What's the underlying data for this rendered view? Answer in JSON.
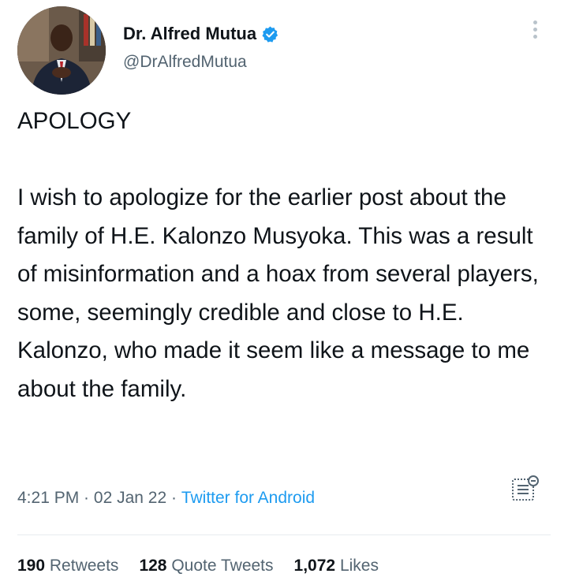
{
  "author": {
    "display_name": "Dr. Alfred Mutua",
    "handle": "@DrAlfredMutua",
    "verified": true,
    "avatar_icon": "profile-photo"
  },
  "tweet": {
    "paragraphs": [
      "APOLOGY",
      "I wish to apologize for the earlier post about the family of H.E. Kalonzo Musyoka. This was a result of misinformation and a hoax from several players, some, seemingly credible and close to H.E. Kalonzo, who made it seem like a message to me about the family."
    ],
    "time": "4:21 PM",
    "date": "02 Jan 22",
    "separator": " · ",
    "source": "Twitter for Android"
  },
  "stats": {
    "retweets_count": "190",
    "retweets_label": "Retweets",
    "quotes_count": "128",
    "quotes_label": "Quote Tweets",
    "likes_count": "1,072",
    "likes_label": "Likes"
  },
  "icons": {
    "verified": "verified-badge-icon",
    "more": "more-options-icon",
    "analytics": "tweet-analytics-icon"
  },
  "colors": {
    "text": "#0f1419",
    "secondary": "#536471",
    "accent": "#1d9bf0",
    "divider": "#e7ebee"
  }
}
